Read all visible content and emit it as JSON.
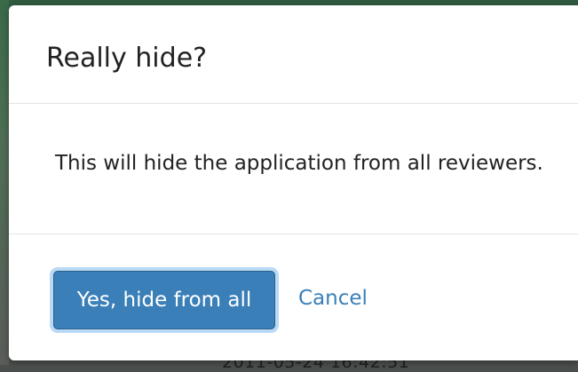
{
  "background": {
    "partial_text": "2011-05-24 16:42:51"
  },
  "dialog": {
    "title": "Really hide?",
    "message": "This will hide the application from all reviewers.",
    "confirm_label": "Yes, hide from all",
    "cancel_label": "Cancel"
  },
  "colors": {
    "primary": "#3a7fb7",
    "primary_focus_ring": "#b9d9f5",
    "text": "#222222",
    "divider": "#e3e3e3"
  }
}
